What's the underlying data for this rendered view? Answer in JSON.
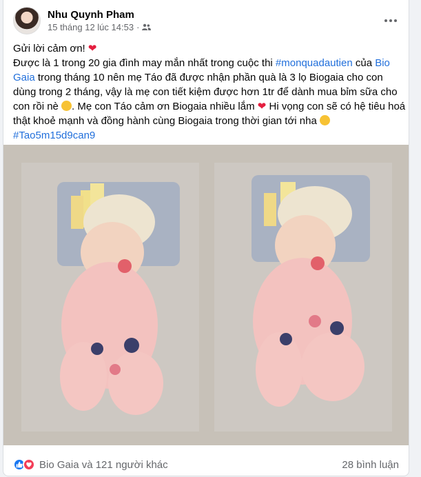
{
  "post": {
    "author": "Nhu Quynh Pham",
    "timestamp": "15 tháng 12 lúc 14:53",
    "audience_icon": "friends-icon",
    "body": {
      "line1": "Gửi lời cảm ơn! ",
      "p2_a": "Được là 1 trong 20 gia đình may mắn nhất trong cuộc thi ",
      "p2_hashtag": "#monquadautien",
      "p2_b": " của ",
      "p2_page": "Bio Gaia",
      "p2_c": " trong tháng 10 nên mẹ Táo đã được nhận phần quà là 3 lọ Biogaia cho con dùng trong 2 tháng, vậy là mẹ con tiết kiệm được hơn 1tr để dành mua bỉm sữa cho con rồi nè ",
      "p2_d": ". Mẹ con Táo cảm ơn Biogaia nhiều lắm ",
      "p2_e": " Hi vọng con sẽ có hệ tiêu hoá thật khoẻ mạnh và đồng hành cùng Biogaia trong thời gian tới nha ",
      "hashtag2": "#Tao5m15d9can9"
    },
    "photos": [
      {
        "alt": "baby-photo-1"
      },
      {
        "alt": "baby-photo-2"
      }
    ],
    "reactions_text": "Bio Gaia và 121 người khác",
    "comments_text": "28 bình luận",
    "colors": {
      "link": "#216fdb",
      "like": "#1877f2",
      "love": "#f33e58",
      "muted": "#65676b"
    }
  }
}
